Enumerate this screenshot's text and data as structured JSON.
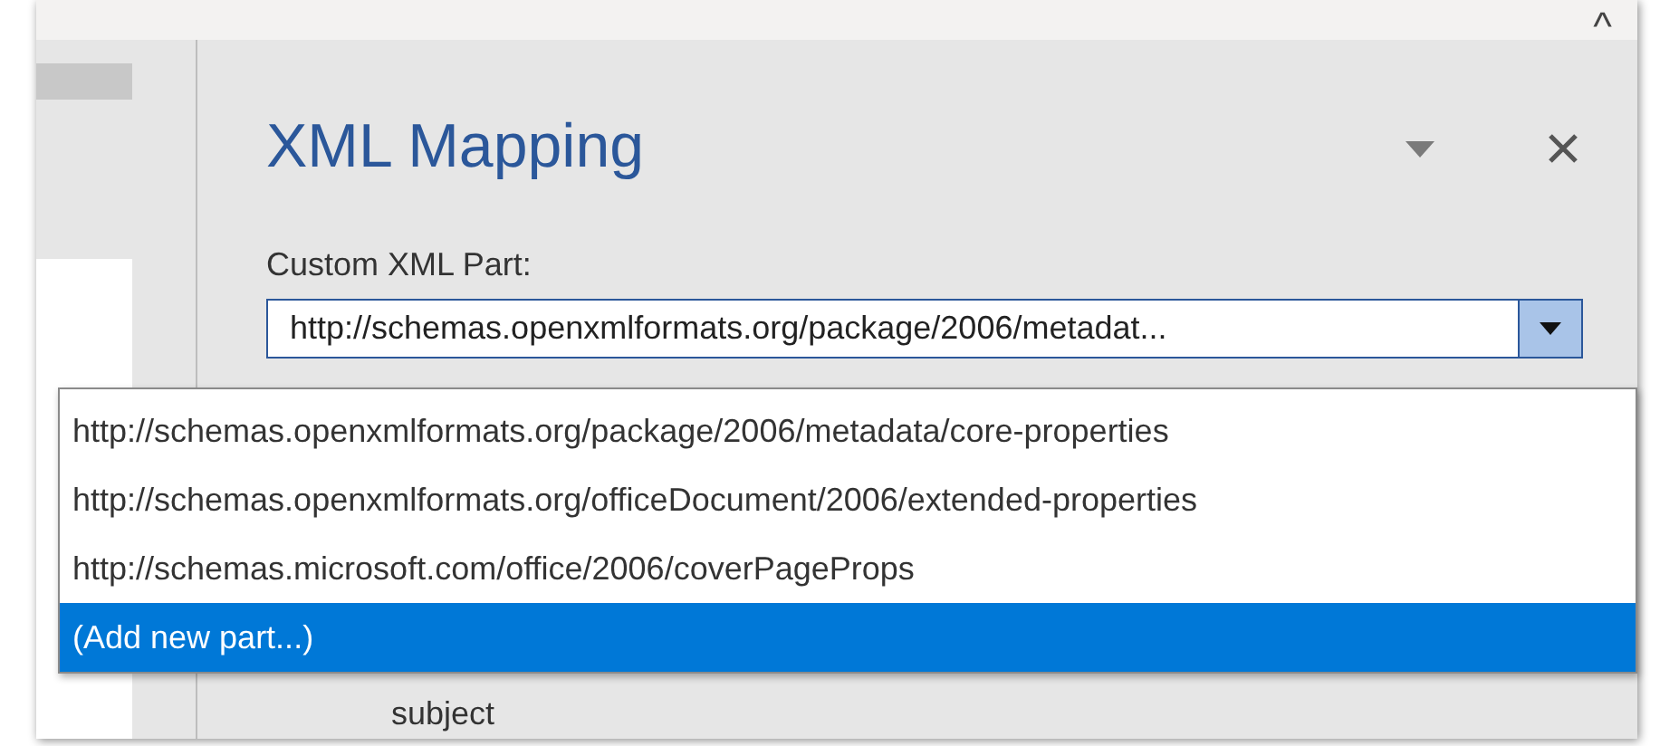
{
  "ribbon": {
    "collapse_glyph": "^"
  },
  "pane": {
    "title": "XML Mapping",
    "label": "Custom XML Part:",
    "value": "http://schemas.openxmlformats.org/package/2006/metadat..."
  },
  "dropdown": {
    "options": [
      {
        "text": "http://schemas.openxmlformats.org/package/2006/metadata/core-properties",
        "selected": false
      },
      {
        "text": "http://schemas.openxmlformats.org/officeDocument/2006/extended-properties",
        "selected": false
      },
      {
        "text": "http://schemas.microsoft.com/office/2006/coverPageProps",
        "selected": false
      },
      {
        "text": "(Add new part...)",
        "selected": true
      }
    ]
  },
  "tree": {
    "items": [
      "subject"
    ]
  }
}
